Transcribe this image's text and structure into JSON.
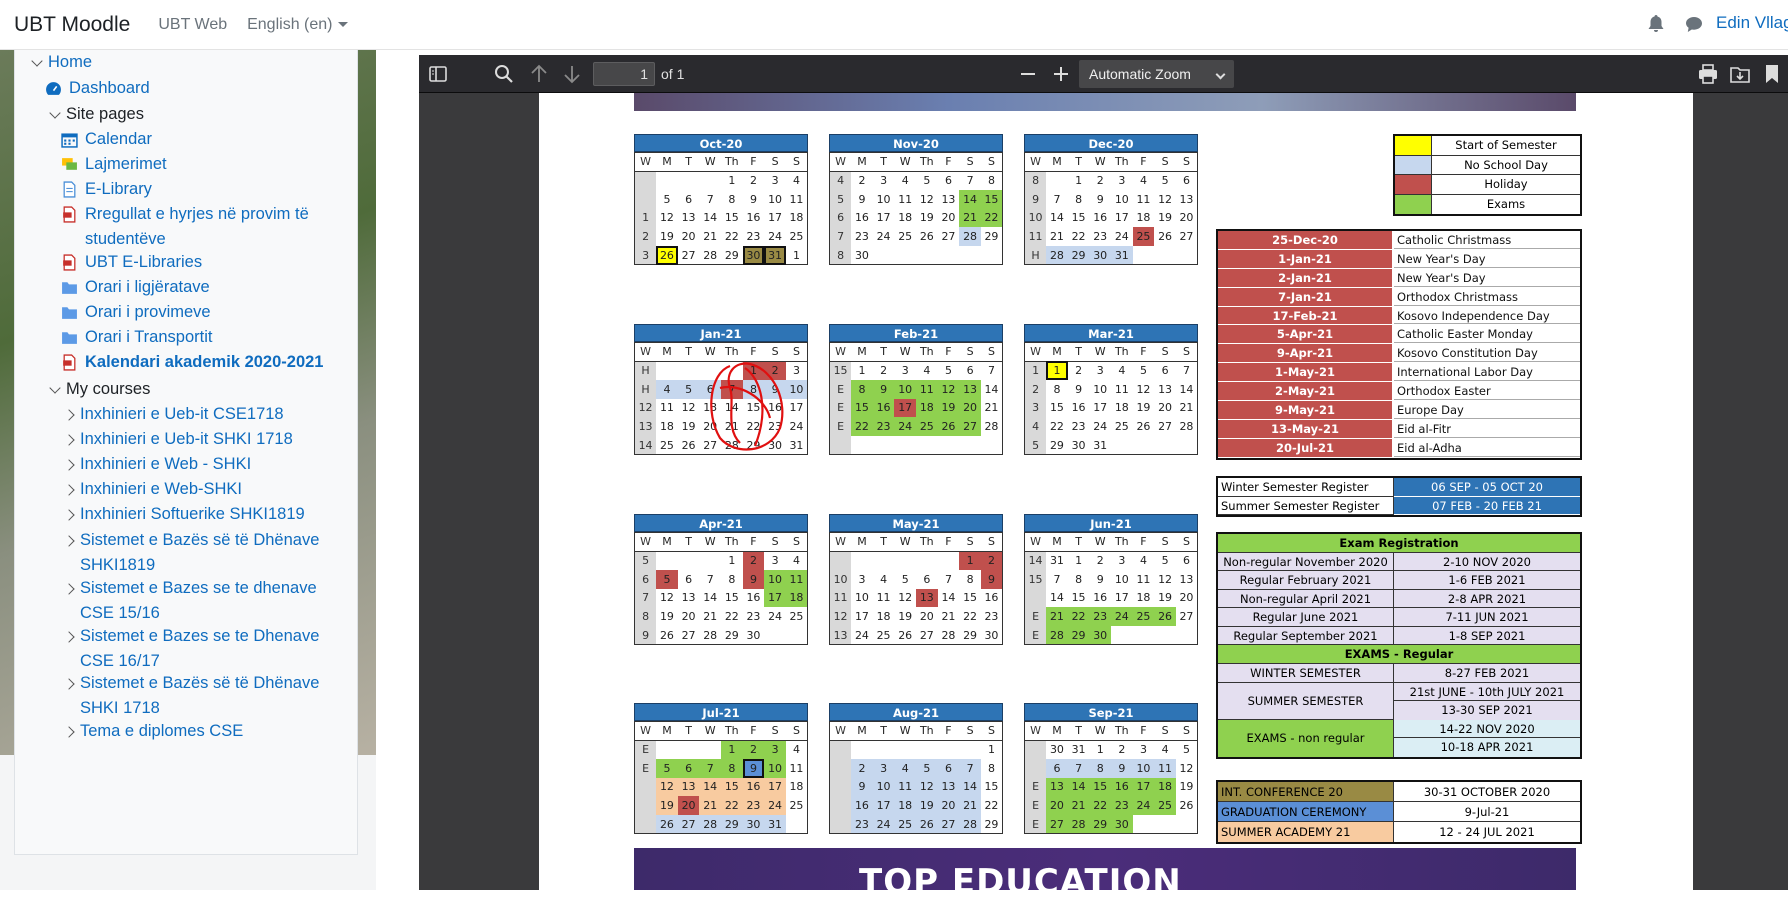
{
  "topbar": {
    "brand": "UBT Moodle",
    "web_link": "UBT Web",
    "language": "English (en)",
    "user_name": "Edin Vllag"
  },
  "sidebar": {
    "items": [
      {
        "label": "Home",
        "icon": "chevron-down-icon"
      },
      {
        "label": "Dashboard",
        "icon": "dashboard-icon"
      },
      {
        "label": "Site pages",
        "icon": "chevron-down-icon"
      },
      {
        "label": "Calendar",
        "icon": "calendar-icon"
      },
      {
        "label": "Lajmerimet",
        "icon": "forum-icon"
      },
      {
        "label": "E-Library",
        "icon": "page-icon"
      },
      {
        "label": "Rregullat e hyrjes në provim të studentëve",
        "icon": "pdf-icon"
      },
      {
        "label": "UBT E-Libraries",
        "icon": "pdf-icon"
      },
      {
        "label": "Orari i ligjëratave",
        "icon": "folder-icon"
      },
      {
        "label": "Orari i provimeve",
        "icon": "folder-icon"
      },
      {
        "label": "Orari i Transportit",
        "icon": "folder-icon"
      },
      {
        "label": "Kalendari akademik 2020-2021",
        "icon": "pdf-icon"
      },
      {
        "label": "My courses",
        "icon": "chevron-down-icon"
      },
      {
        "label": "Inxhinieri e Ueb-it CSE1718",
        "icon": "chevron-right-icon"
      },
      {
        "label": "Inxhinieri e Ueb-it SHKI 1718",
        "icon": "chevron-right-icon"
      },
      {
        "label": "Inxhinieri e Web - SHKI",
        "icon": "chevron-right-icon"
      },
      {
        "label": " Inxhinieri e Web-SHKI",
        "icon": "chevron-right-icon"
      },
      {
        "label": "Inxhinieri Softuerike SHKI1819",
        "icon": "chevron-right-icon"
      },
      {
        "label": "Sistemet e Bazës së të Dhënave SHKI1819",
        "icon": "chevron-right-icon"
      },
      {
        "label": "Sistemet e Bazes se te dhenave CSE 15/16",
        "icon": "chevron-right-icon"
      },
      {
        "label": "Sistemet e Bazes se te Dhenave CSE 16/17",
        "icon": "chevron-right-icon"
      },
      {
        "label": "Sistemet e Bazës së të Dhënave SHKI 1718",
        "icon": "chevron-right-icon"
      },
      {
        "label": "Tema e diplomes CSE",
        "icon": "chevron-right-icon"
      }
    ]
  },
  "viewer": {
    "page_number": "1",
    "page_count": "of 1",
    "zoom": "Automatic Zoom"
  },
  "calendar": {
    "day_headers": [
      "W",
      "M",
      "T",
      "W",
      "Th",
      "F",
      "S",
      "S"
    ],
    "legend": [
      {
        "label": "Start of Semester",
        "color": "#ffff00"
      },
      {
        "label": "No School Day",
        "color": "#c6d7ee"
      },
      {
        "label": "Holiday",
        "color": "#c0504d"
      },
      {
        "label": "Exams",
        "color": "#8fd14f"
      }
    ],
    "holidays": [
      {
        "date": "25-Dec-20",
        "name": "Catholic Christmass"
      },
      {
        "date": "1-Jan-21",
        "name": "New Year's Day"
      },
      {
        "date": "2-Jan-21",
        "name": "New Year's Day"
      },
      {
        "date": "7-Jan-21",
        "name": "Orthodox Christmass"
      },
      {
        "date": "17-Feb-21",
        "name": "Kosovo Independence Day"
      },
      {
        "date": "5-Apr-21",
        "name": "Catholic Easter Monday"
      },
      {
        "date": "9-Apr-21",
        "name": "Kosovo Constitution Day"
      },
      {
        "date": "1-May-21",
        "name": "International Labor Day"
      },
      {
        "date": "2-May-21",
        "name": "Orthodox Easter"
      },
      {
        "date": "9-May-21",
        "name": "Europe Day"
      },
      {
        "date": "13-May-21",
        "name": "Eid al-Fitr"
      },
      {
        "date": "20-Jul-21",
        "name": "Eid al-Adha"
      }
    ],
    "registration": [
      {
        "label": "Winter Semester Register",
        "value": "06 SEP - 05 OCT 20"
      },
      {
        "label": "Summer Semester Register",
        "value": "07 FEB - 20 FEB 21"
      }
    ],
    "exam_registration": {
      "title": "Exam Registration",
      "rows": [
        {
          "label": "Non-regular November 2020",
          "value": "2-10 NOV 2020"
        },
        {
          "label": "Regular February 2021",
          "value": "1-6 FEB 2021"
        },
        {
          "label": "Non-regular April 2021",
          "value": "2-8 APR 2021"
        },
        {
          "label": "Regular June 2021",
          "value": "7-11 JUN 2021"
        },
        {
          "label": "Regular September 2021",
          "value": "1-8 SEP 2021"
        }
      ],
      "regular_title": "EXAMS - Regular",
      "winter_label": "WINTER SEMESTER",
      "winter_value": "8-27 FEB 2021",
      "summer_label": "SUMMER SEMESTER",
      "summer_values": [
        "21st  JUNE - 10th JULY 2021",
        "13-30 SEP 2021"
      ],
      "nonreg_label": "EXAMS - non regular",
      "nonreg_values": [
        "14-22 NOV 2020",
        "10-18 APR 2021"
      ]
    },
    "events": [
      {
        "label": "INT. CONFERENCE 20",
        "value": "30-31 OCTOBER 2020",
        "color": "#998a44"
      },
      {
        "label": "GRADUATION CEREMONY",
        "value": "9-Jul-21",
        "color": "#5b8fd6"
      },
      {
        "label": "SUMMER ACADEMY 21",
        "value": "12 - 24 JUL 2021",
        "color": "#f8cba0"
      }
    ],
    "footer_text": "TOP EDUCATION",
    "months": [
      {
        "name": "Oct-20",
        "rows": [
          [
            "",
            "",
            "",
            "",
            "1",
            "2",
            "3",
            "4"
          ],
          [
            "",
            "5",
            "6",
            "7",
            "8",
            "9",
            "10",
            "11"
          ],
          [
            "1",
            "12",
            "13",
            "14",
            "15",
            "16",
            "17",
            "18"
          ],
          [
            "2",
            "19",
            "20",
            "21",
            "22",
            "23",
            "24",
            "25"
          ],
          [
            "3",
            "26",
            "27",
            "28",
            "29",
            "30",
            "31",
            "1"
          ]
        ]
      },
      {
        "name": "Nov-20",
        "rows": [
          [
            "4",
            "2",
            "3",
            "4",
            "5",
            "6",
            "7",
            "8"
          ],
          [
            "5",
            "9",
            "10",
            "11",
            "12",
            "13",
            "14",
            "15"
          ],
          [
            "6",
            "16",
            "17",
            "18",
            "19",
            "20",
            "21",
            "22"
          ],
          [
            "7",
            "23",
            "24",
            "25",
            "26",
            "27",
            "28",
            "29"
          ],
          [
            "8",
            "30",
            "",
            "",
            "",
            "",
            "",
            ""
          ]
        ]
      },
      {
        "name": "Dec-20",
        "rows": [
          [
            "8",
            "",
            "1",
            "2",
            "3",
            "4",
            "5",
            "6"
          ],
          [
            "9",
            "7",
            "8",
            "9",
            "10",
            "11",
            "12",
            "13"
          ],
          [
            "10",
            "14",
            "15",
            "16",
            "17",
            "18",
            "19",
            "20"
          ],
          [
            "11",
            "21",
            "22",
            "23",
            "24",
            "25",
            "26",
            "27"
          ],
          [
            "H",
            "28",
            "29",
            "30",
            "31",
            "",
            "",
            ""
          ]
        ]
      },
      {
        "name": "Jan-21",
        "rows": [
          [
            "H",
            "",
            "",
            "",
            "",
            "1",
            "2",
            "3"
          ],
          [
            "H",
            "4",
            "5",
            "6",
            "7",
            "8",
            "9",
            "10"
          ],
          [
            "12",
            "11",
            "12",
            "13",
            "14",
            "15",
            "16",
            "17"
          ],
          [
            "13",
            "18",
            "19",
            "20",
            "21",
            "22",
            "23",
            "24"
          ],
          [
            "14",
            "25",
            "26",
            "27",
            "28",
            "29",
            "30",
            "31"
          ]
        ]
      },
      {
        "name": "Feb-21",
        "rows": [
          [
            "15",
            "1",
            "2",
            "3",
            "4",
            "5",
            "6",
            "7"
          ],
          [
            "E",
            "8",
            "9",
            "10",
            "11",
            "12",
            "13",
            "14"
          ],
          [
            "E",
            "15",
            "16",
            "17",
            "18",
            "19",
            "20",
            "21"
          ],
          [
            "E",
            "22",
            "23",
            "24",
            "25",
            "26",
            "27",
            "28"
          ],
          [
            "",
            "",
            "",
            "",
            "",
            "",
            "",
            ""
          ]
        ]
      },
      {
        "name": "Mar-21",
        "rows": [
          [
            "1",
            "1",
            "2",
            "3",
            "4",
            "5",
            "6",
            "7"
          ],
          [
            "2",
            "8",
            "9",
            "10",
            "11",
            "12",
            "13",
            "14"
          ],
          [
            "3",
            "15",
            "16",
            "17",
            "18",
            "19",
            "20",
            "21"
          ],
          [
            "4",
            "22",
            "23",
            "24",
            "25",
            "26",
            "27",
            "28"
          ],
          [
            "5",
            "29",
            "30",
            "31",
            "",
            "",
            "",
            ""
          ]
        ]
      },
      {
        "name": "Apr-21",
        "rows": [
          [
            "5",
            "",
            "",
            "",
            "1",
            "2",
            "3",
            "4"
          ],
          [
            "6",
            "5",
            "6",
            "7",
            "8",
            "9",
            "10",
            "11"
          ],
          [
            "7",
            "12",
            "13",
            "14",
            "15",
            "16",
            "17",
            "18"
          ],
          [
            "8",
            "19",
            "20",
            "21",
            "22",
            "23",
            "24",
            "25"
          ],
          [
            "9",
            "26",
            "27",
            "28",
            "29",
            "30",
            "",
            ""
          ]
        ]
      },
      {
        "name": "May-21",
        "rows": [
          [
            "",
            "",
            "",
            "",
            "",
            "",
            "1",
            "2"
          ],
          [
            "10",
            "3",
            "4",
            "5",
            "6",
            "7",
            "8",
            "9"
          ],
          [
            "11",
            "10",
            "11",
            "12",
            "13",
            "14",
            "15",
            "16"
          ],
          [
            "12",
            "17",
            "18",
            "19",
            "20",
            "21",
            "22",
            "23"
          ],
          [
            "13",
            "24",
            "25",
            "26",
            "27",
            "28",
            "29",
            "30"
          ]
        ]
      },
      {
        "name": "Jun-21",
        "rows": [
          [
            "14",
            "31",
            "1",
            "2",
            "3",
            "4",
            "5",
            "6"
          ],
          [
            "15",
            "7",
            "8",
            "9",
            "10",
            "11",
            "12",
            "13"
          ],
          [
            "",
            "14",
            "15",
            "16",
            "17",
            "18",
            "19",
            "20"
          ],
          [
            "E",
            "21",
            "22",
            "23",
            "24",
            "25",
            "26",
            "27"
          ],
          [
            "E",
            "28",
            "29",
            "30",
            "",
            "",
            "",
            ""
          ]
        ]
      },
      {
        "name": "Jul-21",
        "rows": [
          [
            "E",
            "",
            "",
            "",
            "1",
            "2",
            "3",
            "4"
          ],
          [
            "E",
            "5",
            "6",
            "7",
            "8",
            "9",
            "10",
            "11"
          ],
          [
            "",
            "12",
            "13",
            "14",
            "15",
            "16",
            "17",
            "18"
          ],
          [
            "",
            "19",
            "20",
            "21",
            "22",
            "23",
            "24",
            "25"
          ],
          [
            "",
            "26",
            "27",
            "28",
            "29",
            "30",
            "31",
            ""
          ]
        ]
      },
      {
        "name": "Aug-21",
        "rows": [
          [
            "",
            "",
            "",
            "",
            "",
            "",
            "",
            "1"
          ],
          [
            "",
            "2",
            "3",
            "4",
            "5",
            "6",
            "7",
            "8"
          ],
          [
            "",
            "9",
            "10",
            "11",
            "12",
            "13",
            "14",
            "15"
          ],
          [
            "",
            "16",
            "17",
            "18",
            "19",
            "20",
            "21",
            "22"
          ],
          [
            "",
            "23",
            "24",
            "25",
            "26",
            "27",
            "28",
            "29"
          ]
        ]
      },
      {
        "name": "Sep-21",
        "rows": [
          [
            "",
            "30",
            "31",
            "1",
            "2",
            "3",
            "4",
            "5"
          ],
          [
            "",
            "6",
            "7",
            "8",
            "9",
            "10",
            "11",
            "12"
          ],
          [
            "E",
            "13",
            "14",
            "15",
            "16",
            "17",
            "18",
            "19"
          ],
          [
            "E",
            "20",
            "21",
            "22",
            "23",
            "24",
            "25",
            "26"
          ],
          [
            "E",
            "27",
            "28",
            "29",
            "30",
            "",
            "",
            ""
          ]
        ]
      }
    ],
    "month_colors": [
      {
        "4-1": "y",
        "4-5": "k",
        "4-6": "k"
      },
      {
        "1-6": "g",
        "1-7": "g",
        "2-6": "g",
        "2-7": "g",
        "3-6": "b"
      },
      {
        "3-5": "r",
        "4-1": "b",
        "4-2": "b",
        "4-3": "b",
        "4-4": "b"
      },
      {
        "0-5": "r",
        "0-6": "r",
        "1-1": "b",
        "1-2": "b",
        "1-3": "b",
        "1-4": "r",
        "1-5": "b",
        "1-6": "b",
        "1-7": "b"
      },
      {
        "1-1": "g",
        "1-2": "g",
        "1-3": "g",
        "1-4": "g",
        "1-5": "g",
        "1-6": "g",
        "2-1": "g",
        "2-2": "g",
        "2-3": "r",
        "2-4": "g",
        "2-5": "g",
        "2-6": "g",
        "3-1": "g",
        "3-2": "g",
        "3-3": "g",
        "3-4": "g",
        "3-5": "g",
        "3-6": "g"
      },
      {
        "0-1": "y"
      },
      {
        "0-5": "r",
        "1-1": "r",
        "1-5": "r",
        "1-6": "g",
        "1-7": "g",
        "2-6": "g",
        "2-7": "g"
      },
      {
        "0-6": "r",
        "0-7": "r",
        "1-7": "r",
        "2-4": "r"
      },
      {
        "3-1": "g",
        "3-2": "g",
        "3-3": "g",
        "3-4": "g",
        "3-5": "g",
        "3-6": "g",
        "4-1": "g",
        "4-2": "g",
        "4-3": "g"
      },
      {
        "0-4": "g",
        "0-5": "g",
        "0-6": "g",
        "1-1": "g",
        "1-2": "g",
        "1-3": "g",
        "1-4": "g",
        "1-5": "bl",
        "1-6": "g",
        "2-1": "o",
        "2-2": "o",
        "2-3": "o",
        "2-4": "o",
        "2-5": "o",
        "2-6": "o",
        "3-1": "o",
        "3-2": "r",
        "3-3": "o",
        "3-4": "o",
        "3-5": "o",
        "3-6": "o",
        "4-1": "b",
        "4-2": "b",
        "4-3": "b",
        "4-4": "b",
        "4-5": "b",
        "4-6": "b"
      },
      {
        "1-1": "b",
        "1-2": "b",
        "1-3": "b",
        "1-4": "b",
        "1-5": "b",
        "1-6": "b",
        "2-1": "b",
        "2-2": "b",
        "2-3": "b",
        "2-4": "b",
        "2-5": "b",
        "2-6": "b",
        "3-1": "b",
        "3-2": "b",
        "3-3": "b",
        "3-4": "b",
        "3-5": "b",
        "3-6": "b",
        "4-1": "b",
        "4-2": "b",
        "4-3": "b",
        "4-4": "b",
        "4-5": "b",
        "4-6": "b"
      },
      {
        "1-1": "b",
        "1-2": "b",
        "1-3": "b",
        "1-4": "b",
        "1-5": "b",
        "1-6": "b",
        "2-1": "g",
        "2-2": "g",
        "2-3": "g",
        "2-4": "g",
        "2-5": "g",
        "2-6": "g",
        "3-1": "g",
        "3-2": "g",
        "3-3": "g",
        "3-4": "g",
        "3-5": "g",
        "3-6": "g",
        "4-1": "g",
        "4-2": "g",
        "4-3": "g",
        "4-4": "g"
      }
    ],
    "month_boxes": [
      [
        "4-1",
        "4-5",
        "4-6"
      ],
      [],
      [],
      [],
      [],
      [
        "0-1"
      ],
      [],
      [],
      [],
      [
        "1-5"
      ],
      [],
      []
    ]
  }
}
